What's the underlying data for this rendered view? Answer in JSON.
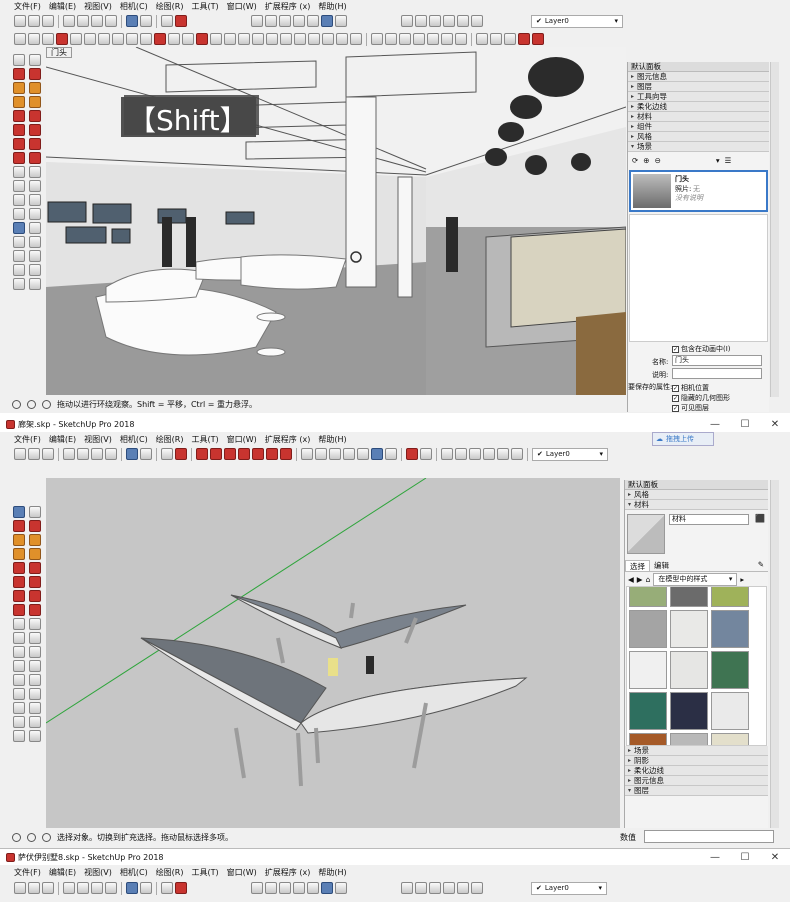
{
  "menu": [
    "文件(F)",
    "编辑(E)",
    "视图(V)",
    "相机(C)",
    "绘图(R)",
    "工具(T)",
    "窗口(W)",
    "扩展程序 (x)",
    "帮助(H)"
  ],
  "layer_name": "Layer0",
  "win1": {
    "scene_tab": "门头",
    "overlay_text": "【Shift】",
    "status_text": "拖动以进行环绕观察。Shift = 平移，Ctrl = 重力悬浮。",
    "tray_title": "默认面板",
    "sections": [
      "图元信息",
      "图层",
      "工具向导",
      "柔化边线",
      "材料",
      "组件",
      "风格",
      "场景"
    ],
    "scene_name": "门头",
    "scene_photo_label": "照片:",
    "scene_photo_value": "无",
    "scene_desc": "没有说明",
    "include_animation": "包含在动画中(I)",
    "name_label": "名称:",
    "name_value": "门头",
    "desc_label": "说明:",
    "props_label": "要保存的属性:",
    "props": [
      "相机位置",
      "隐藏的几何图形",
      "可见图层"
    ]
  },
  "win2": {
    "title": "廊架.skp - SketchUp Pro 2018",
    "cloud_btn": "拖拽上传",
    "status_text": "选择对象。切换到扩充选择。拖动鼠标选择多项。",
    "value_label": "数值",
    "tray_title": "默认面板",
    "top_sections": [
      "风格",
      "材料"
    ],
    "material_name": "材料",
    "tab_select": "选择",
    "tab_edit": "编辑",
    "dropdown": "在模型中的样式",
    "bottom_sections": [
      "场景",
      "阴影",
      "柔化边线",
      "图元信息",
      "图层"
    ],
    "swatches": [
      "#97ad78",
      "#6b6b6b",
      "#9fb25a",
      "#a4a4a4",
      "#e9e9e7",
      "#73869e",
      "#f0f0f0",
      "#e6e6e4",
      "#3f7452",
      "#2e6f5f",
      "#2b2f45",
      "#eaeaea",
      "#a55a28",
      "#b9b9b9",
      "#e3dfcb"
    ]
  },
  "win3": {
    "title": "萨伏伊别墅8.skp - SketchUp Pro 2018"
  },
  "colors": {
    "red_accent": "#c8342f",
    "selection_blue": "#3a79c8"
  }
}
